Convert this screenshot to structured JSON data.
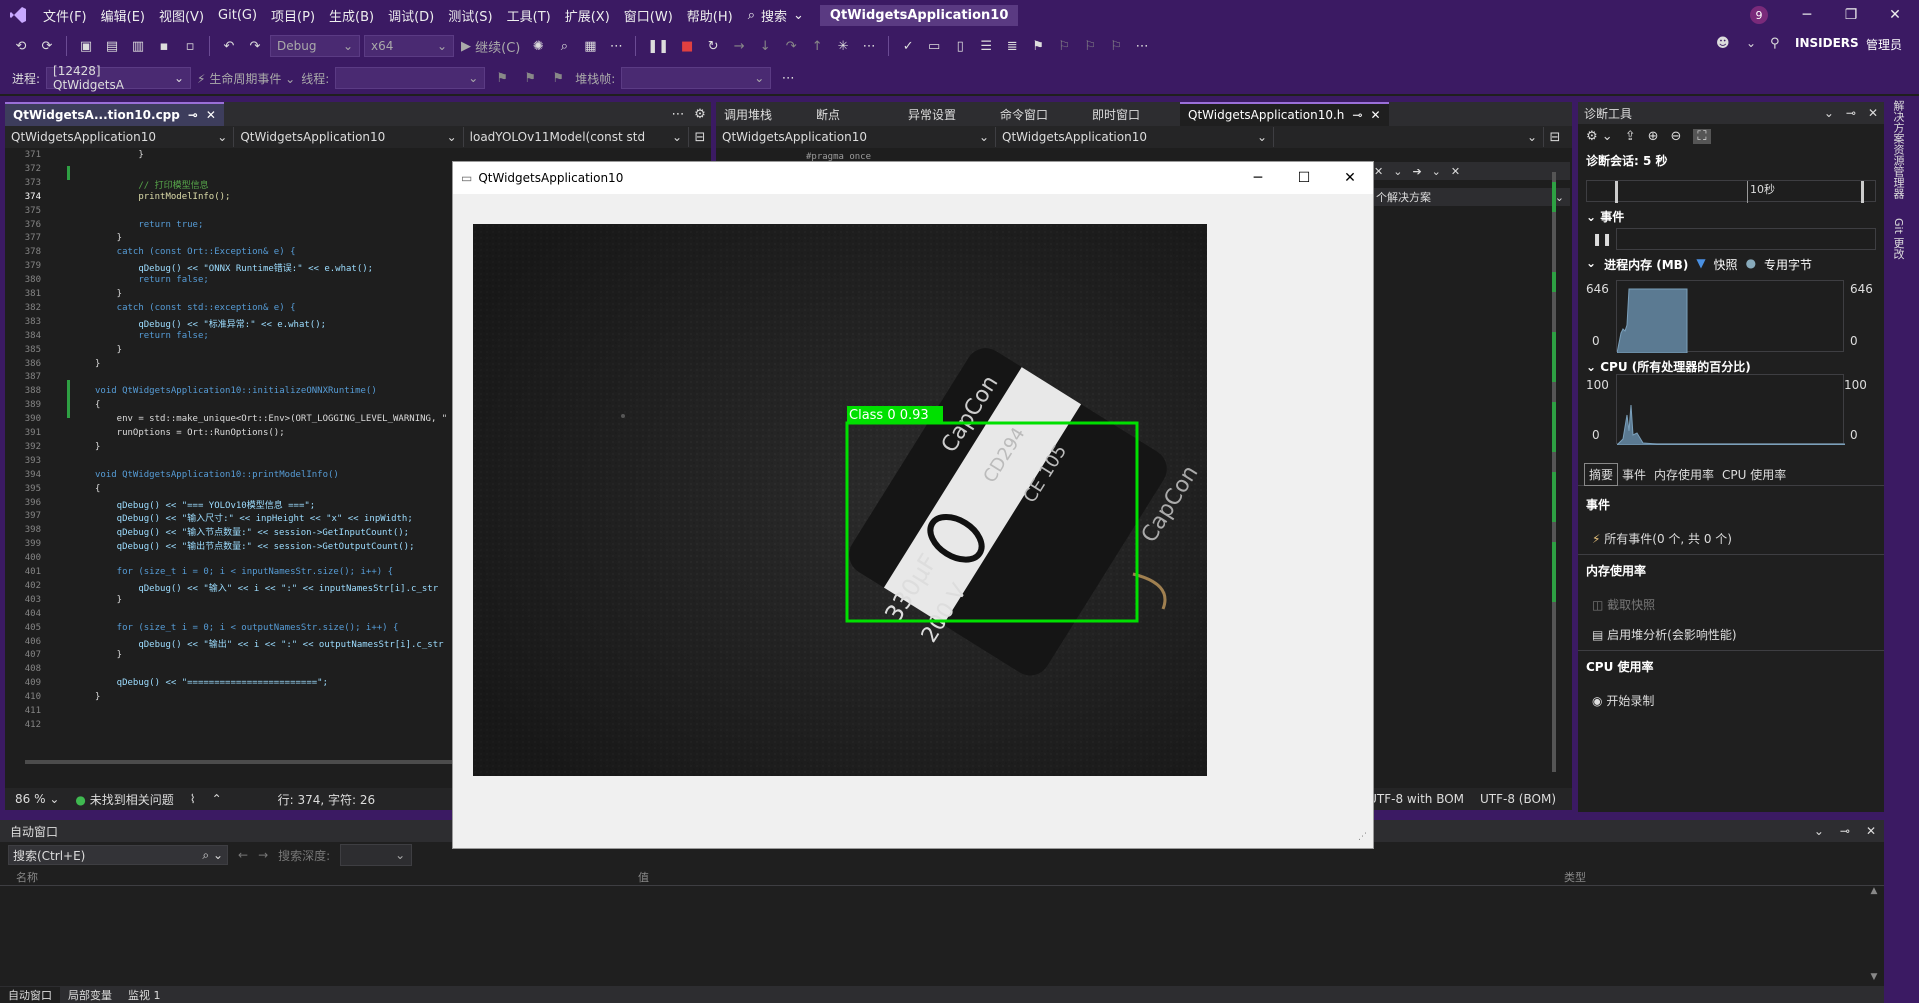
{
  "menu": {
    "items": [
      "文件(F)",
      "编辑(E)",
      "视图(V)",
      "Git(G)",
      "项目(P)",
      "生成(B)",
      "调试(D)",
      "测试(S)",
      "工具(T)",
      "扩展(X)",
      "窗口(W)",
      "帮助(H)"
    ],
    "search_label": "搜索",
    "app_title": "QtWidgetsApplication10",
    "notification_count": "9"
  },
  "toolbar": {
    "config": "Debug",
    "platform": "x64",
    "continue_label": "继续(C)",
    "insiders": "INSIDERS",
    "admin": "管理员"
  },
  "toolbar2": {
    "process_label": "进程:",
    "process_value": "[12428] QtWidgetsA",
    "lifecycle_label": "生命周期事件",
    "thread_label": "线程:",
    "stackframe_label": "堆栈帧:"
  },
  "editor": {
    "tab_label": "QtWidgetsA...tion10.cpp",
    "nav_project": "QtWidgetsApplication10",
    "nav_scope": "QtWidgetsApplication10",
    "nav_member": "loadYOLOv11Model(const std",
    "zoom": "86 %",
    "issues": "未找到相关问题",
    "position": "行: 374, 字符: 26",
    "lines": [
      {
        "n": "371",
        "t": "        }"
      },
      {
        "n": "372",
        "t": ""
      },
      {
        "n": "373",
        "t": "        // 打印模型信息"
      },
      {
        "n": "374",
        "t": "        printModelInfo();"
      },
      {
        "n": "375",
        "t": ""
      },
      {
        "n": "376",
        "t": "        return true;"
      },
      {
        "n": "377",
        "t": "    }"
      },
      {
        "n": "378",
        "t": "    catch (const Ort::Exception& e) {"
      },
      {
        "n": "379",
        "t": "        qDebug() << \"ONNX Runtime错误:\" << e.what();"
      },
      {
        "n": "380",
        "t": "        return false;"
      },
      {
        "n": "381",
        "t": "    }"
      },
      {
        "n": "382",
        "t": "    catch (const std::exception& e) {"
      },
      {
        "n": "383",
        "t": "        qDebug() << \"标准异常:\" << e.what();"
      },
      {
        "n": "384",
        "t": "        return false;"
      },
      {
        "n": "385",
        "t": "    }"
      },
      {
        "n": "386",
        "t": "}"
      },
      {
        "n": "387",
        "t": ""
      },
      {
        "n": "388",
        "t": "void QtWidgetsApplication10::initializeONNXRuntime()"
      },
      {
        "n": "389",
        "t": "{"
      },
      {
        "n": "390",
        "t": "    env = std::make_unique<Ort::Env>(ORT_LOGGING_LEVEL_WARNING, \""
      },
      {
        "n": "391",
        "t": "    runOptions = Ort::RunOptions();"
      },
      {
        "n": "392",
        "t": "}"
      },
      {
        "n": "393",
        "t": ""
      },
      {
        "n": "394",
        "t": "void QtWidgetsApplication10::printModelInfo()"
      },
      {
        "n": "395",
        "t": "{"
      },
      {
        "n": "396",
        "t": "    qDebug() << \"=== YOLOv10模型信息 ===\";"
      },
      {
        "n": "397",
        "t": "    qDebug() << \"输入尺寸:\" << inpHeight << \"x\" << inpWidth;"
      },
      {
        "n": "398",
        "t": "    qDebug() << \"输入节点数量:\" << session->GetInputCount();"
      },
      {
        "n": "399",
        "t": "    qDebug() << \"输出节点数量:\" << session->GetOutputCount();"
      },
      {
        "n": "400",
        "t": ""
      },
      {
        "n": "401",
        "t": "    for (size_t i = 0; i < inputNamesStr.size(); i++) {"
      },
      {
        "n": "402",
        "t": "        qDebug() << \"输入\" << i << \":\" << inputNamesStr[i].c_str"
      },
      {
        "n": "403",
        "t": "    }"
      },
      {
        "n": "404",
        "t": ""
      },
      {
        "n": "405",
        "t": "    for (size_t i = 0; i < outputNamesStr.size(); i++) {"
      },
      {
        "n": "406",
        "t": "        qDebug() << \"输出\" << i << \":\" << outputNamesStr[i].c_str"
      },
      {
        "n": "407",
        "t": "    }"
      },
      {
        "n": "408",
        "t": ""
      },
      {
        "n": "409",
        "t": "    qDebug() << \"========================\";"
      },
      {
        "n": "410",
        "t": "}"
      },
      {
        "n": "411",
        "t": ""
      },
      {
        "n": "412",
        "t": ""
      }
    ]
  },
  "middle_tabs": [
    "调用堆栈",
    "断点",
    "异常设置",
    "命令窗口",
    "即时窗口"
  ],
  "header_tab": "QtWidgetsApplication10.h",
  "header_nav": [
    "QtWidgetsApplication10",
    "QtWidgetsApplication10"
  ],
  "header_code": "#pragma once",
  "header_hint": "个解决方案",
  "header_status": [
    "UTF-8 with BOM",
    "UTF-8 (BOM)"
  ],
  "qt_window": {
    "title": "QtWidgetsApplication10",
    "detection_label": "Class 0 0.93",
    "cap_text": [
      "CapCon",
      "CD294",
      "CE 105",
      "330μF",
      "200 V",
      "CapCon"
    ]
  },
  "diagnostics": {
    "title": "诊断工具",
    "session": "诊断会话: 5 秒",
    "timeline_tick": "10秒",
    "events_title": "事件",
    "memory_title": "进程内存 (MB)",
    "memory_legend": [
      "快照",
      "专用字节"
    ],
    "memory_max": "646",
    "memory_min": "0",
    "cpu_title": "CPU (所有处理器的百分比)",
    "cpu_max": "100",
    "cpu_min": "0",
    "tabs": [
      "摘要",
      "事件",
      "内存使用率",
      "CPU 使用率"
    ],
    "events_header": "事件",
    "all_events": "所有事件(0 个, 共 0 个)",
    "memory_header": "内存使用率",
    "snapshot": "截取快照",
    "heap": "启用堆分析(会影响性能)",
    "cpu_header": "CPU 使用率",
    "record": "开始录制"
  },
  "side_tabs": [
    "解决方案资源管理器",
    "Git 更改"
  ],
  "autos": {
    "title": "自动窗口",
    "search_placeholder": "搜索(Ctrl+E)",
    "depth_label": "搜索深度:",
    "columns": [
      "名称",
      "值",
      "类型"
    ],
    "bottom_tabs": [
      "自动窗口",
      "局部变量",
      "监视 1"
    ]
  }
}
